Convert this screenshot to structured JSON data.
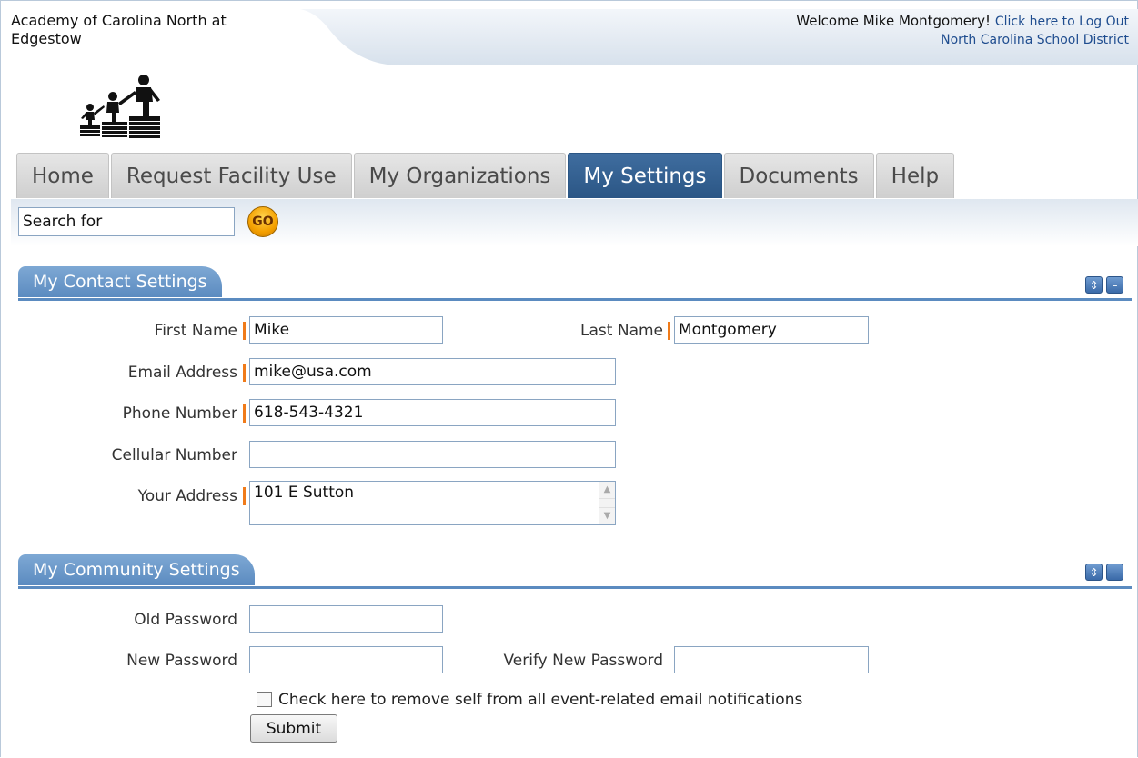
{
  "header": {
    "school_name": "Academy of Carolina North at Edgestow",
    "welcome": "Welcome Mike Montgomery!",
    "logout_link": "Click here to Log Out",
    "district": "North Carolina School District"
  },
  "tabs": [
    {
      "label": "Home"
    },
    {
      "label": "Request Facility Use"
    },
    {
      "label": "My Organizations"
    },
    {
      "label": "My Settings",
      "active": true
    },
    {
      "label": "Documents"
    },
    {
      "label": "Help"
    }
  ],
  "search": {
    "value": "Search for",
    "go_label": "GO"
  },
  "contact": {
    "title": "My Contact Settings",
    "first_name_label": "First Name",
    "first_name": "Mike",
    "last_name_label": "Last Name",
    "last_name": "Montgomery",
    "email_label": "Email Address",
    "email": "mike@usa.com",
    "phone_label": "Phone Number",
    "phone": "618-543-4321",
    "cell_label": "Cellular Number",
    "cell": "",
    "address_label": "Your Address",
    "address": "101 E Sutton"
  },
  "community": {
    "title": "My Community Settings",
    "old_password_label": "Old Password",
    "new_password_label": "New Password",
    "verify_password_label": "Verify New Password",
    "checkbox_label": "Check here to remove self from all event-related email notifications",
    "submit_label": "Submit"
  },
  "colors": {
    "accent": "#2b5685",
    "section": "#5b8bc0",
    "required_marker": "#f07b1a",
    "go_button": "#f5a000"
  }
}
